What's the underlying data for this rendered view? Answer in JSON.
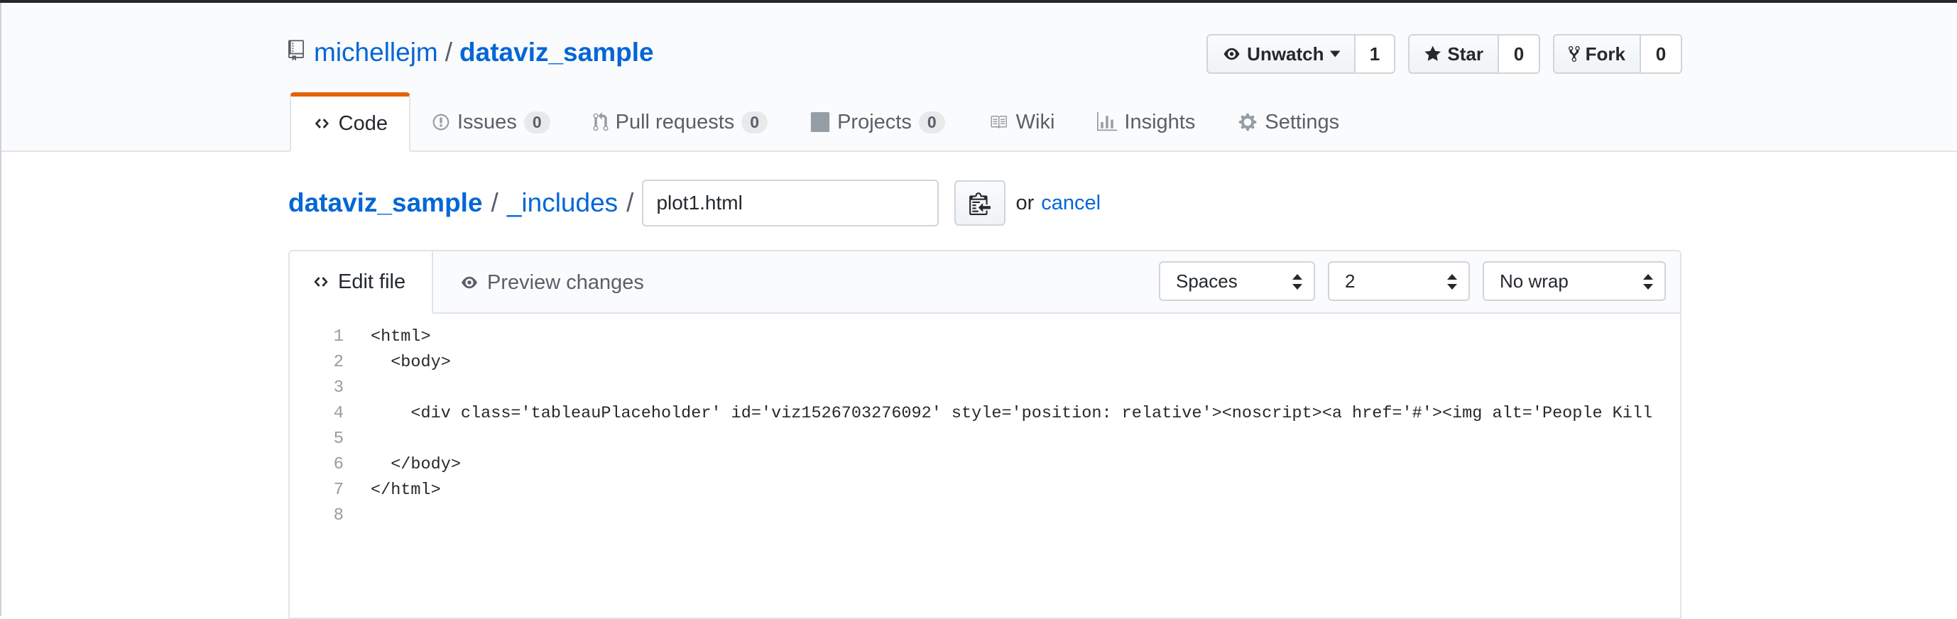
{
  "repo": {
    "owner": "michellejm",
    "separator": "/",
    "name": "dataviz_sample",
    "icon": "repo-icon"
  },
  "actions": {
    "watch": {
      "label": "Unwatch",
      "count": "1",
      "icon": "eye-icon"
    },
    "star": {
      "label": "Star",
      "count": "0",
      "icon": "star-icon"
    },
    "fork": {
      "label": "Fork",
      "count": "0",
      "icon": "fork-icon"
    }
  },
  "nav": {
    "code": {
      "label": "Code",
      "icon": "code-icon"
    },
    "issues": {
      "label": "Issues",
      "count": "0",
      "icon": "issue-icon"
    },
    "pulls": {
      "label": "Pull requests",
      "count": "0",
      "icon": "pull-request-icon"
    },
    "projects": {
      "label": "Projects",
      "count": "0",
      "icon": "project-icon"
    },
    "wiki": {
      "label": "Wiki",
      "icon": "book-icon"
    },
    "insights": {
      "label": "Insights",
      "icon": "graph-icon"
    },
    "settings": {
      "label": "Settings",
      "icon": "gear-icon"
    }
  },
  "breadcrumb": {
    "root": "dataviz_sample",
    "sep": "/",
    "folder": "_includes",
    "filename_value": "plot1.html",
    "or_text": "or",
    "cancel_label": "cancel"
  },
  "editor": {
    "tab_edit": "Edit file",
    "tab_preview": "Preview changes",
    "indent_mode": "Spaces",
    "indent_size": "2",
    "wrap_mode": "No wrap",
    "lines": [
      {
        "num": "1",
        "text": "<html>"
      },
      {
        "num": "2",
        "text": "  <body>"
      },
      {
        "num": "3",
        "text": ""
      },
      {
        "num": "4",
        "text": "    <div class='tableauPlaceholder' id='viz1526703276092' style='position: relative'><noscript><a href='#'><img alt='People Kill"
      },
      {
        "num": "5",
        "text": ""
      },
      {
        "num": "6",
        "text": "  </body>"
      },
      {
        "num": "7",
        "text": "</html>"
      },
      {
        "num": "8",
        "text": ""
      }
    ]
  },
  "colors": {
    "link": "#0366d6",
    "tab_accent": "#e36209",
    "header_bg": "#fafbfc",
    "border": "#e1e4e8"
  }
}
